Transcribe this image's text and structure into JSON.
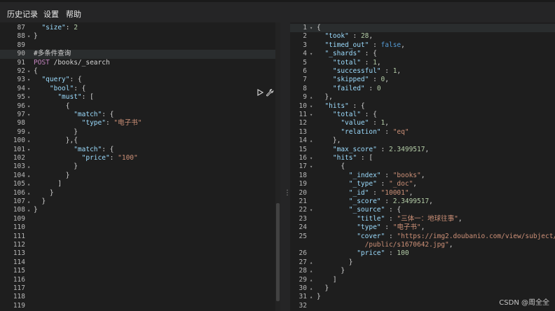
{
  "menu": {
    "items": [
      "历史记录",
      "设置",
      "帮助"
    ]
  },
  "left_editor": {
    "lines": [
      {
        "n": "87",
        "fold": "",
        "text": [
          [
            "k",
            "  \"size\""
          ],
          [
            "p",
            ": "
          ],
          [
            "n",
            "2"
          ]
        ]
      },
      {
        "n": "88",
        "fold": "▾",
        "text": [
          [
            "p",
            "}"
          ]
        ]
      },
      {
        "n": "89",
        "fold": "",
        "text": []
      },
      {
        "n": "90",
        "fold": "",
        "text": [
          [
            "cm",
            "#多条件查询"
          ]
        ],
        "highlight": true
      },
      {
        "n": "91",
        "fold": "",
        "text": [
          [
            "m",
            "POST"
          ],
          [
            "p",
            " /books/_search"
          ]
        ]
      },
      {
        "n": "92",
        "fold": "▾",
        "text": [
          [
            "p",
            "{"
          ]
        ]
      },
      {
        "n": "93",
        "fold": "▾",
        "text": [
          [
            "k",
            "  \"query\""
          ],
          [
            "p",
            ": {"
          ]
        ]
      },
      {
        "n": "94",
        "fold": "▾",
        "text": [
          [
            "k",
            "    \"bool\""
          ],
          [
            "p",
            ": {"
          ]
        ]
      },
      {
        "n": "95",
        "fold": "▾",
        "text": [
          [
            "k",
            "      \"must\""
          ],
          [
            "p",
            ": ["
          ]
        ]
      },
      {
        "n": "96",
        "fold": "▾",
        "text": [
          [
            "p",
            "        {"
          ]
        ]
      },
      {
        "n": "97",
        "fold": "▾",
        "text": [
          [
            "k",
            "          \"match\""
          ],
          [
            "p",
            ": {"
          ]
        ]
      },
      {
        "n": "98",
        "fold": "",
        "text": [
          [
            "k",
            "            \"type\""
          ],
          [
            "p",
            ": "
          ],
          [
            "s",
            "\"电子书\""
          ]
        ]
      },
      {
        "n": "99",
        "fold": "▴",
        "text": [
          [
            "p",
            "          }"
          ]
        ]
      },
      {
        "n": "100",
        "fold": "▴",
        "text": [
          [
            "p",
            "        },{"
          ]
        ]
      },
      {
        "n": "101",
        "fold": "▾",
        "text": [
          [
            "k",
            "          \"match\""
          ],
          [
            "p",
            ": {"
          ]
        ]
      },
      {
        "n": "102",
        "fold": "",
        "text": [
          [
            "k",
            "            \"price\""
          ],
          [
            "p",
            ": "
          ],
          [
            "s",
            "\"100\""
          ]
        ]
      },
      {
        "n": "103",
        "fold": "▴",
        "text": [
          [
            "p",
            "          }"
          ]
        ]
      },
      {
        "n": "104",
        "fold": "▴",
        "text": [
          [
            "p",
            "        }"
          ]
        ]
      },
      {
        "n": "105",
        "fold": "▴",
        "text": [
          [
            "p",
            "      ]"
          ]
        ]
      },
      {
        "n": "106",
        "fold": "▴",
        "text": [
          [
            "p",
            "    }"
          ]
        ]
      },
      {
        "n": "107",
        "fold": "▴",
        "text": [
          [
            "p",
            "  }"
          ]
        ]
      },
      {
        "n": "108",
        "fold": "▴",
        "text": [
          [
            "p",
            "}"
          ]
        ]
      },
      {
        "n": "109",
        "fold": "",
        "text": []
      },
      {
        "n": "110",
        "fold": "",
        "text": []
      },
      {
        "n": "111",
        "fold": "",
        "text": []
      },
      {
        "n": "112",
        "fold": "",
        "text": []
      },
      {
        "n": "113",
        "fold": "",
        "text": []
      },
      {
        "n": "114",
        "fold": "",
        "text": []
      },
      {
        "n": "115",
        "fold": "",
        "text": []
      },
      {
        "n": "116",
        "fold": "",
        "text": []
      },
      {
        "n": "117",
        "fold": "",
        "text": []
      },
      {
        "n": "118",
        "fold": "",
        "text": []
      },
      {
        "n": "119",
        "fold": "",
        "text": []
      }
    ]
  },
  "right_editor": {
    "lines": [
      {
        "n": "1",
        "fold": "▾",
        "text": [
          [
            "p",
            "{"
          ]
        ],
        "highlight": true
      },
      {
        "n": "2",
        "fold": "",
        "text": [
          [
            "k",
            "  \"took\""
          ],
          [
            "p",
            " : "
          ],
          [
            "n",
            "28"
          ],
          [
            "p",
            ","
          ]
        ]
      },
      {
        "n": "3",
        "fold": "",
        "text": [
          [
            "k",
            "  \"timed_out\""
          ],
          [
            "p",
            " : "
          ],
          [
            "b",
            "false"
          ],
          [
            "p",
            ","
          ]
        ]
      },
      {
        "n": "4",
        "fold": "▾",
        "text": [
          [
            "k",
            "  \"_shards\""
          ],
          [
            "p",
            " : {"
          ]
        ]
      },
      {
        "n": "5",
        "fold": "",
        "text": [
          [
            "k",
            "    \"total\""
          ],
          [
            "p",
            " : "
          ],
          [
            "n",
            "1"
          ],
          [
            "p",
            ","
          ]
        ]
      },
      {
        "n": "6",
        "fold": "",
        "text": [
          [
            "k",
            "    \"successful\""
          ],
          [
            "p",
            " : "
          ],
          [
            "n",
            "1"
          ],
          [
            "p",
            ","
          ]
        ]
      },
      {
        "n": "7",
        "fold": "",
        "text": [
          [
            "k",
            "    \"skipped\""
          ],
          [
            "p",
            " : "
          ],
          [
            "n",
            "0"
          ],
          [
            "p",
            ","
          ]
        ]
      },
      {
        "n": "8",
        "fold": "",
        "text": [
          [
            "k",
            "    \"failed\""
          ],
          [
            "p",
            " : "
          ],
          [
            "n",
            "0"
          ]
        ]
      },
      {
        "n": "9",
        "fold": "▴",
        "text": [
          [
            "p",
            "  },"
          ]
        ]
      },
      {
        "n": "10",
        "fold": "▾",
        "text": [
          [
            "k",
            "  \"hits\""
          ],
          [
            "p",
            " : {"
          ]
        ]
      },
      {
        "n": "11",
        "fold": "▾",
        "text": [
          [
            "k",
            "    \"total\""
          ],
          [
            "p",
            " : {"
          ]
        ]
      },
      {
        "n": "12",
        "fold": "",
        "text": [
          [
            "k",
            "      \"value\""
          ],
          [
            "p",
            " : "
          ],
          [
            "n",
            "1"
          ],
          [
            "p",
            ","
          ]
        ]
      },
      {
        "n": "13",
        "fold": "",
        "text": [
          [
            "k",
            "      \"relation\""
          ],
          [
            "p",
            " : "
          ],
          [
            "s",
            "\"eq\""
          ]
        ]
      },
      {
        "n": "14",
        "fold": "▴",
        "text": [
          [
            "p",
            "    },"
          ]
        ]
      },
      {
        "n": "15",
        "fold": "",
        "text": [
          [
            "k",
            "    \"max_score\""
          ],
          [
            "p",
            " : "
          ],
          [
            "n",
            "2.3499517"
          ],
          [
            "p",
            ","
          ]
        ]
      },
      {
        "n": "16",
        "fold": "▾",
        "text": [
          [
            "k",
            "    \"hits\""
          ],
          [
            "p",
            " : ["
          ]
        ]
      },
      {
        "n": "17",
        "fold": "▾",
        "text": [
          [
            "p",
            "      {"
          ]
        ]
      },
      {
        "n": "18",
        "fold": "",
        "text": [
          [
            "k",
            "        \"_index\""
          ],
          [
            "p",
            " : "
          ],
          [
            "s",
            "\"books\""
          ],
          [
            "p",
            ","
          ]
        ]
      },
      {
        "n": "19",
        "fold": "",
        "text": [
          [
            "k",
            "        \"_type\""
          ],
          [
            "p",
            " : "
          ],
          [
            "s",
            "\"_doc\""
          ],
          [
            "p",
            ","
          ]
        ]
      },
      {
        "n": "20",
        "fold": "",
        "text": [
          [
            "k",
            "        \"_id\""
          ],
          [
            "p",
            " : "
          ],
          [
            "s",
            "\"10001\""
          ],
          [
            "p",
            ","
          ]
        ]
      },
      {
        "n": "21",
        "fold": "",
        "text": [
          [
            "k",
            "        \"_score\""
          ],
          [
            "p",
            " : "
          ],
          [
            "n",
            "2.3499517"
          ],
          [
            "p",
            ","
          ]
        ]
      },
      {
        "n": "22",
        "fold": "▾",
        "text": [
          [
            "k",
            "        \"_source\""
          ],
          [
            "p",
            " : {"
          ]
        ]
      },
      {
        "n": "23",
        "fold": "",
        "text": [
          [
            "k",
            "          \"title\""
          ],
          [
            "p",
            " : "
          ],
          [
            "s",
            "\"三体一：地球往事\""
          ],
          [
            "p",
            ","
          ]
        ]
      },
      {
        "n": "24",
        "fold": "",
        "text": [
          [
            "k",
            "          \"type\""
          ],
          [
            "p",
            " : "
          ],
          [
            "s",
            "\"电子书\""
          ],
          [
            "p",
            ","
          ]
        ]
      },
      {
        "n": "25",
        "fold": "",
        "text": [
          [
            "k",
            "          \"cover\""
          ],
          [
            "p",
            " : "
          ],
          [
            "s",
            "\"https://img2.doubanio.com/view/subject/s"
          ]
        ]
      },
      {
        "n": "",
        "fold": "",
        "text": [
          [
            "s",
            "            /public/s1670642.jpg\""
          ],
          [
            "p",
            ","
          ]
        ]
      },
      {
        "n": "26",
        "fold": "",
        "text": [
          [
            "k",
            "          \"price\""
          ],
          [
            "p",
            " : "
          ],
          [
            "n",
            "100"
          ]
        ]
      },
      {
        "n": "27",
        "fold": "▴",
        "text": [
          [
            "p",
            "        }"
          ]
        ]
      },
      {
        "n": "28",
        "fold": "▴",
        "text": [
          [
            "p",
            "      }"
          ]
        ]
      },
      {
        "n": "29",
        "fold": "▴",
        "text": [
          [
            "p",
            "    ]"
          ]
        ]
      },
      {
        "n": "30",
        "fold": "▴",
        "text": [
          [
            "p",
            "  }"
          ]
        ]
      },
      {
        "n": "31",
        "fold": "▴",
        "text": [
          [
            "p",
            "}"
          ]
        ]
      },
      {
        "n": "32",
        "fold": "",
        "text": []
      }
    ]
  },
  "toolbar_icons": [
    "play-icon",
    "wrench-icon"
  ],
  "splitter_glyph": "⋮",
  "watermark": "CSDN @周全全",
  "colors": {
    "background": "#1e1e1e",
    "menubar": "#252526",
    "key": "#9cdcfe",
    "string": "#ce9178",
    "number": "#b5cea8",
    "boolean": "#569cd6",
    "method": "#c586c0"
  }
}
